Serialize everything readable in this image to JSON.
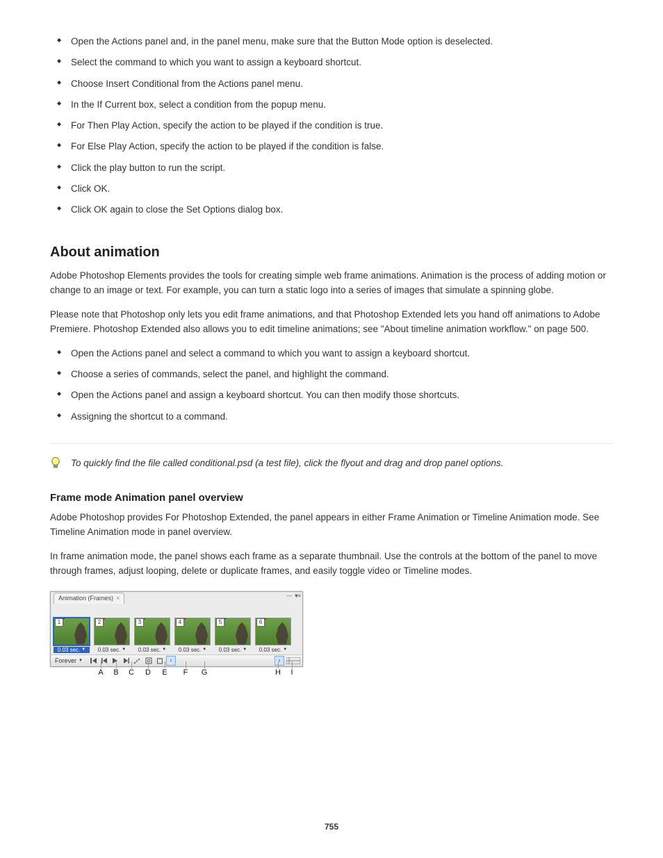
{
  "bulletsTop": [
    "Open the Actions panel and, in the panel menu, make sure that the Button Mode option is deselected.",
    "Select the command to which you want to assign a keyboard shortcut.",
    "Choose Insert Conditional from the Actions panel menu.",
    "In the If Current box, select a condition from the popup menu.",
    "For Then Play Action, specify the action to be played if the condition is true.",
    "For Else Play Action, specify the action to be played if the condition is false.",
    "Click the play button to run the script.",
    "Click OK.",
    "Click OK again to close the Set Options dialog box."
  ],
  "section": {
    "title": "About animation",
    "p1": "Adobe Photoshop Elements provides the tools for creating simple web frame animations. Animation is the process of adding motion or change to an image or text. For example, you can turn a static logo into a series of images that simulate a spinning globe.",
    "p2": "Please note that Photoshop only lets you edit frame animations, and that Photoshop Extended lets you hand off animations to Adobe Premiere. Photoshop Extended also allows you to edit timeline animations; see \"About timeline animation workflow.\" on page 500.",
    "bullets": [
      "Open the Actions panel and select a command to which you want to assign a keyboard shortcut.",
      "Choose a series of commands, select the panel, and highlight the command.",
      "Open the Actions panel and assign a keyboard shortcut. You can then modify those shortcuts.",
      "Assigning the shortcut to a command."
    ]
  },
  "hr": true,
  "tip": "To quickly find the file called conditional.psd (a test file), click the flyout and drag and drop panel options.",
  "sub": {
    "title": "Frame mode Animation panel overview",
    "p1": "Adobe Photoshop provides For Photoshop Extended, the panel appears in either Frame Animation or Timeline Animation mode. See Timeline Animation mode in panel overview.",
    "p2": "In frame animation mode, the panel shows each frame as a separate thumbnail. Use the controls at the bottom of the panel to move through frames, adjust looping, delete or duplicate frames, and easily toggle video or Timeline modes."
  },
  "animPanel": {
    "tab": "Animation (Frames)",
    "frames": [
      {
        "n": 1,
        "dur": "0.03 sec."
      },
      {
        "n": 2,
        "dur": "0.03 sec."
      },
      {
        "n": 3,
        "dur": "0.03 sec."
      },
      {
        "n": 4,
        "dur": "0.03 sec."
      },
      {
        "n": 5,
        "dur": "0.03 sec."
      },
      {
        "n": 6,
        "dur": "0.03 sec."
      }
    ],
    "loop": "Forever"
  },
  "labels": [
    "A",
    "B",
    "C",
    "D",
    "E",
    "F",
    "G",
    "H",
    "I"
  ],
  "labelPositions": [
    73,
    95,
    117,
    141,
    165,
    195,
    222,
    328,
    348
  ],
  "pageNumber": "755"
}
